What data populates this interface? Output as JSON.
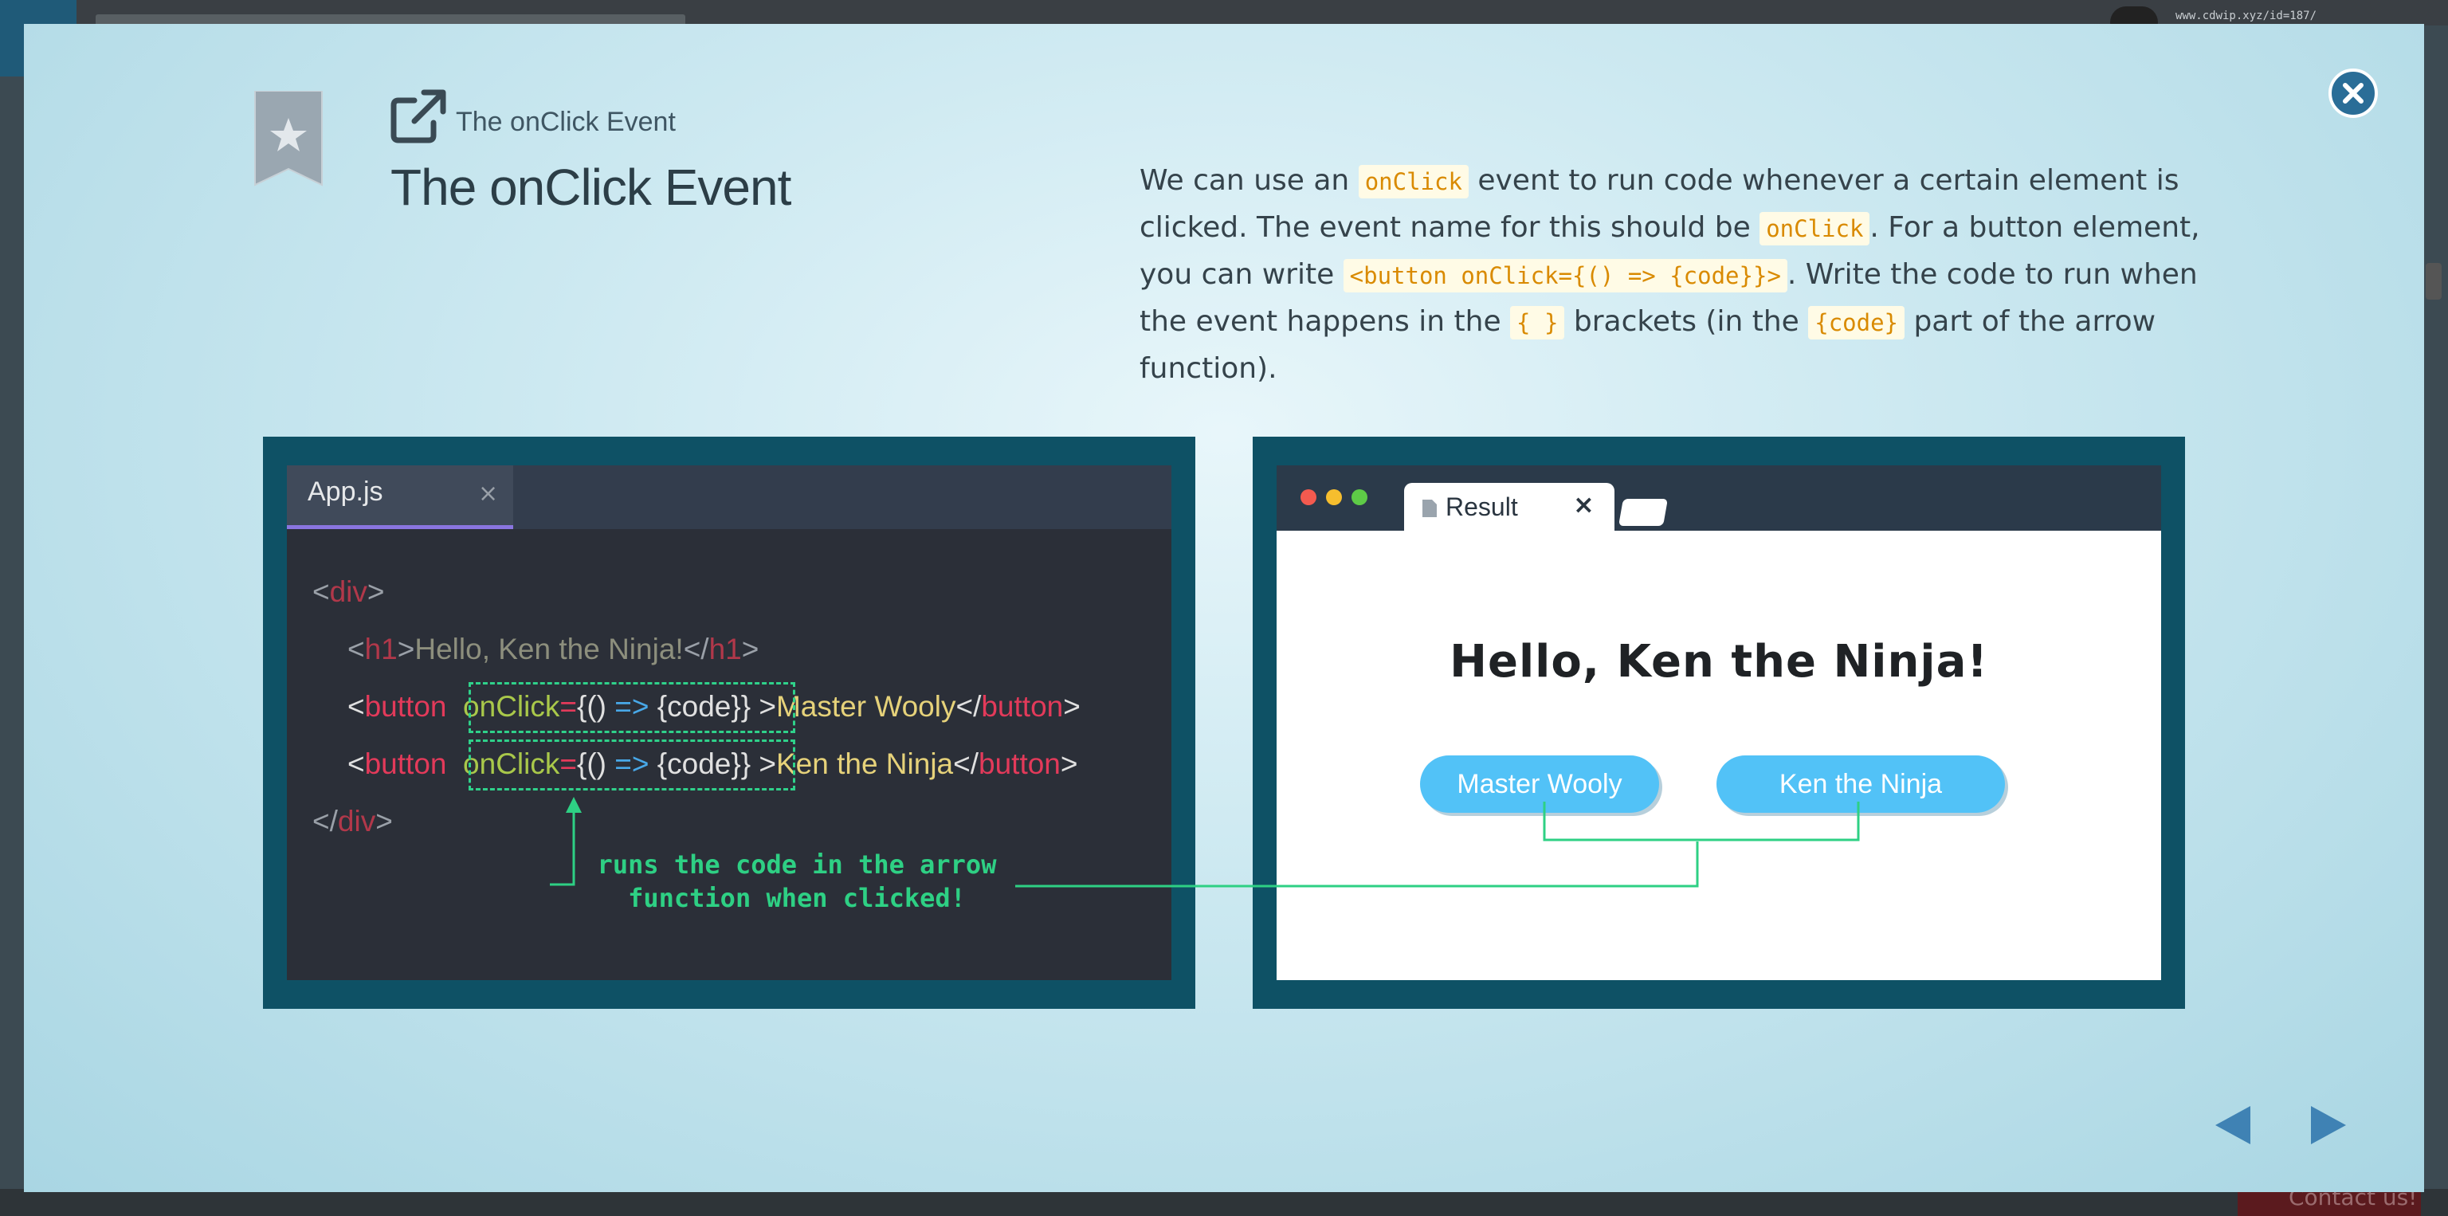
{
  "background": {
    "url_text": "www.cdwip.xyz/id=187/",
    "contact_label": "Contact us!"
  },
  "header": {
    "breadcrumb": "The onClick Event",
    "title": "The onClick Event"
  },
  "description": {
    "p1": "We can use an ",
    "chip1": "onClick",
    "p2": " event to run code whenever a certain element is clicked. The event name for this should be ",
    "chip2": "onClick",
    "p3": ". For a button element, you can write ",
    "chip3": "<button onClick={() => {code}}>",
    "p4": ". Write the code to run when the event happens in the ",
    "chip4": "{ }",
    "p5": " brackets (in the ",
    "chip5": "{code}",
    "p6": " part of the arrow function)."
  },
  "editor": {
    "tab_label": "App.js",
    "tab_close": "×",
    "line1": {
      "lt": "<",
      "tag": "div",
      "gt": ">"
    },
    "line2": {
      "lt": "<",
      "tag": "h1",
      "gt": ">",
      "text": "Hello, Ken the Ninja!",
      "close_lt": "</",
      "close_tag": "h1",
      "close_gt": ">"
    },
    "line3": {
      "lt": "<",
      "tag": "button",
      "attr": "onClick",
      "eq": "=",
      "open": "{()",
      "arrow": " => ",
      "code": "{code}}",
      "gt": ">",
      "text": "Master Wooly",
      "close_lt": "</",
      "close_tag": "button",
      "close_gt": ">"
    },
    "line4": {
      "lt": "<",
      "tag": "button",
      "attr": "onClick",
      "eq": "=",
      "open": "{()",
      "arrow": " => ",
      "code": "{code}}",
      "gt": ">",
      "text": "Ken the Ninja",
      "close_lt": "</",
      "close_tag": "button",
      "close_gt": ">"
    },
    "line5": {
      "lt": "</",
      "tag": "div",
      "gt": ">"
    },
    "annotation_line1": "runs the code in the arrow",
    "annotation_line2": "function when clicked!"
  },
  "browser": {
    "tab_label": "Result",
    "tab_close": "×",
    "heading": "Hello, Ken the Ninja!",
    "button1": "Master Wooly",
    "button2": "Ken the Ninja"
  },
  "colors": {
    "accent": "#2a6d97",
    "panel": "#0e5165",
    "button": "#52c2f7",
    "annotation": "#2ed084"
  }
}
